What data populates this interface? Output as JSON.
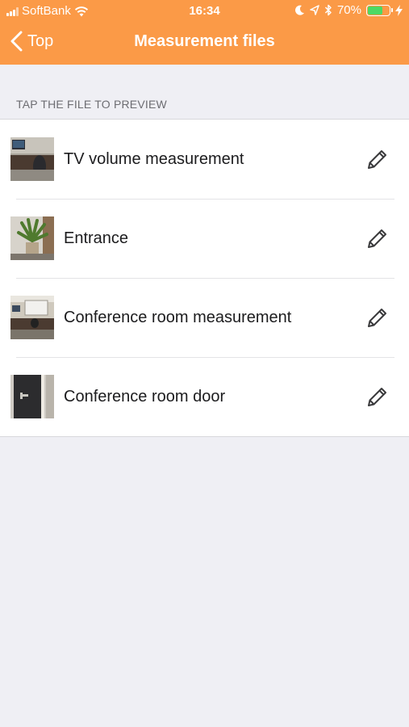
{
  "status_bar": {
    "carrier": "SoftBank",
    "time": "16:34",
    "battery_percent": "70%",
    "battery_level": 0.7,
    "icons": [
      "signal-icon",
      "wifi-icon",
      "moon-icon",
      "location-icon",
      "bluetooth-icon",
      "battery-icon",
      "charging-icon"
    ]
  },
  "nav": {
    "back_label": "Top",
    "title": "Measurement files"
  },
  "section": {
    "header": "TAP THE FILE TO PREVIEW"
  },
  "files": [
    {
      "name": "TV volume measurement",
      "thumbnail": "office-desk-photo",
      "action_icon": "pencil-icon"
    },
    {
      "name": "Entrance",
      "thumbnail": "potted-plant-photo",
      "action_icon": "pencil-icon"
    },
    {
      "name": "Conference room measurement",
      "thumbnail": "conference-room-photo",
      "action_icon": "pencil-icon"
    },
    {
      "name": "Conference room door",
      "thumbnail": "door-handle-photo",
      "action_icon": "pencil-icon"
    }
  ],
  "colors": {
    "header": "#fb9a47",
    "background": "#efeff4",
    "battery": "#4cd964"
  }
}
